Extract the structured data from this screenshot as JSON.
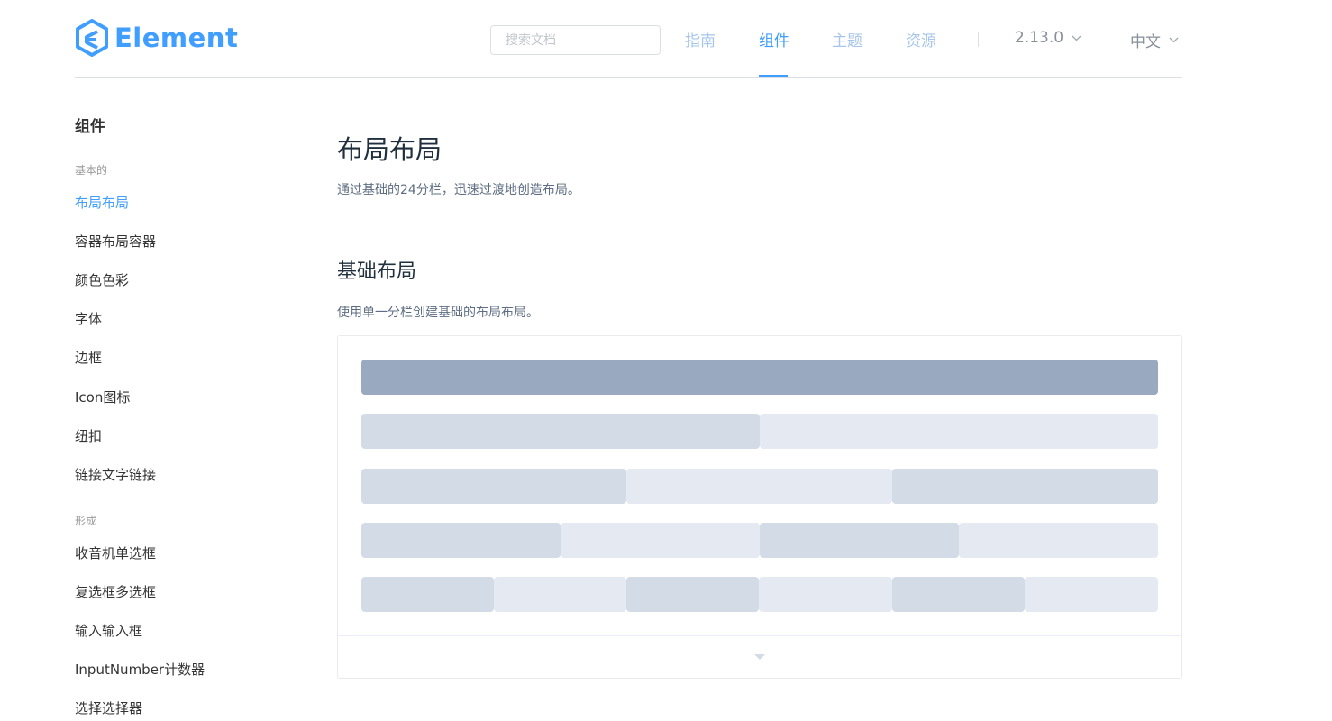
{
  "header": {
    "logo_text": "Element",
    "search_placeholder": "搜索文档",
    "nav": [
      {
        "label": "指南",
        "active": false
      },
      {
        "label": "组件",
        "active": true
      },
      {
        "label": "主题",
        "active": false
      },
      {
        "label": "资源",
        "active": false
      }
    ],
    "version": "2.13.0",
    "language": "中文"
  },
  "sidebar": {
    "heading": "组件",
    "groups": [
      {
        "title": "基本的",
        "items": [
          "布局布局",
          "容器布局容器",
          "颜色色彩",
          "字体",
          "边框",
          "Icon图标",
          "纽扣",
          "链接文字链接"
        ]
      },
      {
        "title": "形成",
        "items": [
          "收音机单选框",
          "复选框多选框",
          "输入输入框",
          "InputNumber计数器",
          "选择选择器"
        ]
      }
    ],
    "active_item": "布局布局"
  },
  "main": {
    "title": "布局布局",
    "description": "通过基础的24分栏，迅速过渡地创造布局。",
    "section_title": "基础布局",
    "section_description": "使用单一分栏创建基础的布局布局。"
  },
  "colors": {
    "accent": "#409eff",
    "nav_inactive": "#a6c6ea",
    "cell_dark": "#99a9bf",
    "cell_mid": "#d3dce6",
    "cell_light": "#e5e9f2"
  },
  "icons": {
    "logo": "element-logo-icon",
    "dropdown": "chevron-down-icon",
    "expand": "caret-down-icon"
  }
}
